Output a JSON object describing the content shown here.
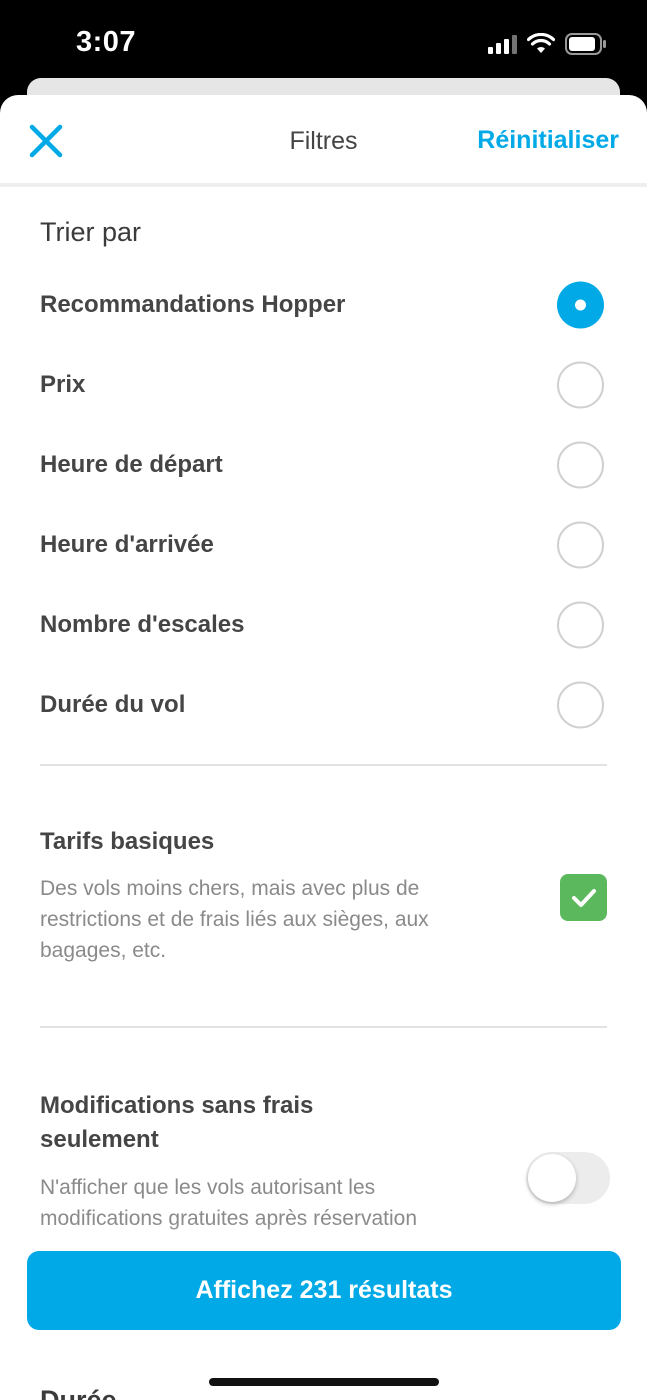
{
  "status_bar": {
    "time": "3:07"
  },
  "header": {
    "title": "Filtres",
    "reset_label": "Réinitialiser"
  },
  "sort": {
    "title": "Trier par",
    "selected_index": 0,
    "options": [
      "Recommandations Hopper",
      "Prix",
      "Heure de départ",
      "Heure d'arrivée",
      "Nombre d'escales",
      "Durée du vol"
    ]
  },
  "basic_fares": {
    "title": "Tarifs basiques",
    "description": "Des vols moins chers, mais avec plus de restrictions et de frais liés aux sièges, aux bagages, etc.",
    "checked": true
  },
  "free_changes": {
    "title": "Modifications sans frais seulement",
    "description": "N'afficher que les vols autorisant les modifications gratuites après réservation",
    "enabled": false
  },
  "next_section_partial": "Durée",
  "cta": {
    "label": "Affichez 231 résultats"
  },
  "colors": {
    "accent": "#01aae6",
    "check_green": "#5cb85c",
    "text_primary": "#454545",
    "text_secondary": "#8a8a8a"
  }
}
